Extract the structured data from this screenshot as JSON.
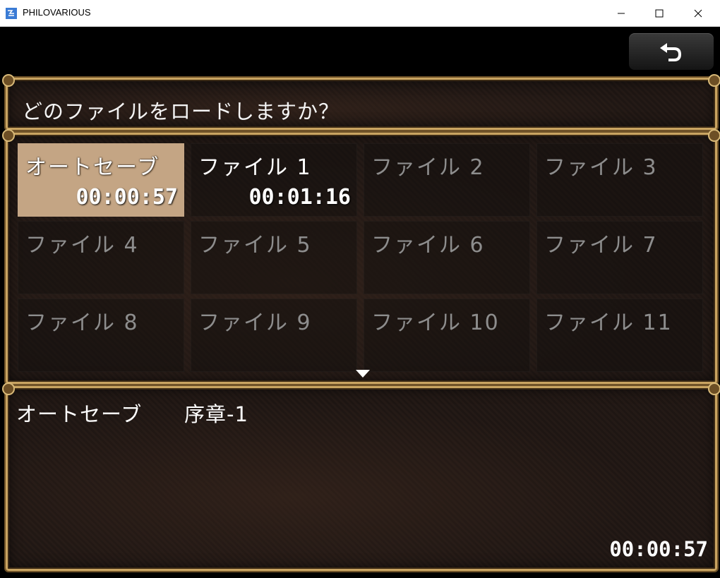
{
  "window": {
    "title": "PHILOVARIOUS"
  },
  "help": {
    "text": "どのファイルをロードしますか？"
  },
  "slots": [
    {
      "name": "オートセーブ",
      "time": "00:00:57"
    },
    {
      "name": "ファイル 1",
      "time": "00:01:16"
    },
    {
      "name": "ファイル 2",
      "time": ""
    },
    {
      "name": "ファイル 3",
      "time": ""
    },
    {
      "name": "ファイル 4",
      "time": ""
    },
    {
      "name": "ファイル 5",
      "time": ""
    },
    {
      "name": "ファイル 6",
      "time": ""
    },
    {
      "name": "ファイル 7",
      "time": ""
    },
    {
      "name": "ファイル 8",
      "time": ""
    },
    {
      "name": "ファイル 9",
      "time": ""
    },
    {
      "name": "ファイル 10",
      "time": ""
    },
    {
      "name": "ファイル 11",
      "time": ""
    }
  ],
  "info": {
    "title": "オートセーブ",
    "chapter": "序章-1",
    "playtime": "00:00:57"
  },
  "colors": {
    "selected_slot": "#c4a584",
    "frame_gold": "#c9a461",
    "empty_text": "#8d8d8d"
  }
}
